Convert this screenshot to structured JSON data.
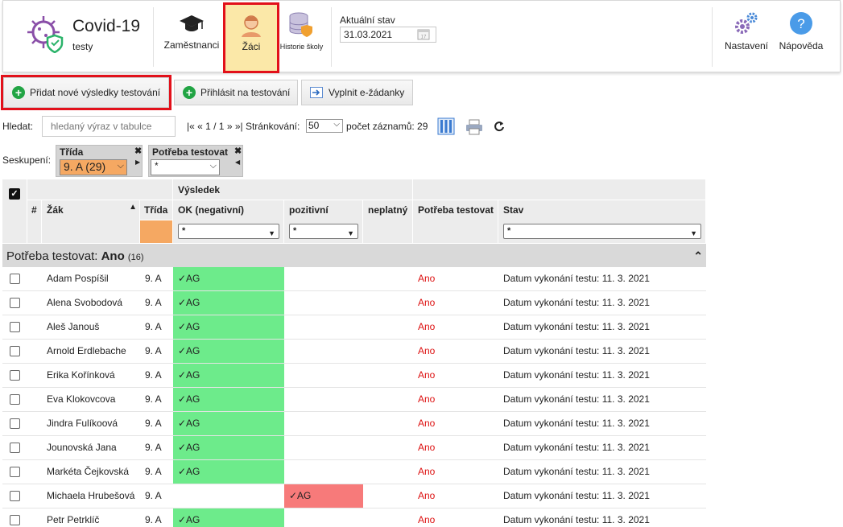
{
  "header": {
    "app_title": "Covid-19",
    "app_subtitle": "testy",
    "nav": [
      {
        "label": "Zaměstnanci"
      },
      {
        "label": "Žáci"
      },
      {
        "label": "Historie školy"
      }
    ],
    "status_label": "Aktuální stav",
    "status_date": "31.03.2021",
    "settings_label": "Nastavení",
    "help_label": "Nápověda"
  },
  "toolbar": {
    "add_results": "Přidat nové výsledky testování",
    "register": "Přihlásit na testování",
    "ezadanky": "Vyplnit e-žádanky"
  },
  "search": {
    "label": "Hledat:",
    "placeholder": "hledaný výraz v tabulce",
    "pager": "|« « 1 / 1 » »|",
    "paging_label": "Stránkování:",
    "page_size": "50",
    "count_label": "počet záznamů: 29"
  },
  "grouping": {
    "label": "Seskupení:",
    "chips": [
      {
        "title": "Třída",
        "value": "9. A (29)"
      },
      {
        "title": "Potřeba testovat",
        "value": "*"
      }
    ]
  },
  "table": {
    "headers": {
      "num": "#",
      "zak": "Žák",
      "trida": "Třída",
      "vysledek": "Výsledek",
      "ok": "OK (negativní)",
      "pozitivni": "pozitivní",
      "neplatny": "neplatný",
      "potreba": "Potřeba testovat",
      "stav": "Stav"
    },
    "filter_value": "*",
    "group_title": "Potřeba testovat:",
    "group_value": "Ano",
    "group_count": "(16)",
    "rows": [
      {
        "name": "Adam Pospíšil",
        "class": "9. A",
        "ok": "✓AG",
        "pos": "",
        "need": "Ano",
        "stav": "Datum vykonání testu: 11. 3. 2021"
      },
      {
        "name": "Alena Svobodová",
        "class": "9. A",
        "ok": "✓AG",
        "pos": "",
        "need": "Ano",
        "stav": "Datum vykonání testu: 11. 3. 2021"
      },
      {
        "name": "Aleš Janouš",
        "class": "9. A",
        "ok": "✓AG",
        "pos": "",
        "need": "Ano",
        "stav": "Datum vykonání testu: 11. 3. 2021"
      },
      {
        "name": "Arnold Erdlebache",
        "class": "9. A",
        "ok": "✓AG",
        "pos": "",
        "need": "Ano",
        "stav": "Datum vykonání testu: 11. 3. 2021"
      },
      {
        "name": "Erika Kořínková",
        "class": "9. A",
        "ok": "✓AG",
        "pos": "",
        "need": "Ano",
        "stav": "Datum vykonání testu: 11. 3. 2021"
      },
      {
        "name": "Eva Klokovcova",
        "class": "9. A",
        "ok": "✓AG",
        "pos": "",
        "need": "Ano",
        "stav": "Datum vykonání testu: 11. 3. 2021"
      },
      {
        "name": "Jindra Fulíkoová",
        "class": "9. A",
        "ok": "✓AG",
        "pos": "",
        "need": "Ano",
        "stav": "Datum vykonání testu: 11. 3. 2021"
      },
      {
        "name": "Jounovská Jana",
        "class": "9. A",
        "ok": "✓AG",
        "pos": "",
        "need": "Ano",
        "stav": "Datum vykonání testu: 11. 3. 2021"
      },
      {
        "name": "Markéta Čejkovská",
        "class": "9. A",
        "ok": "✓AG",
        "pos": "",
        "need": "Ano",
        "stav": "Datum vykonání testu: 11. 3. 2021"
      },
      {
        "name": "Michaela Hrubešová",
        "class": "9. A",
        "ok": "",
        "pos": "✓AG",
        "need": "Ano",
        "stav": "Datum vykonání testu: 11. 3. 2021"
      },
      {
        "name": "Petr Petrklíč",
        "class": "9. A",
        "ok": "✓AG",
        "pos": "",
        "need": "Ano",
        "stav": "Datum vykonání testu: 11. 3. 2021"
      }
    ]
  },
  "colors": {
    "highlight": "#e2101a",
    "ok_cell": "#6deb8b",
    "pos_cell": "#f77a7a",
    "active_nav": "#fbe8a8"
  }
}
